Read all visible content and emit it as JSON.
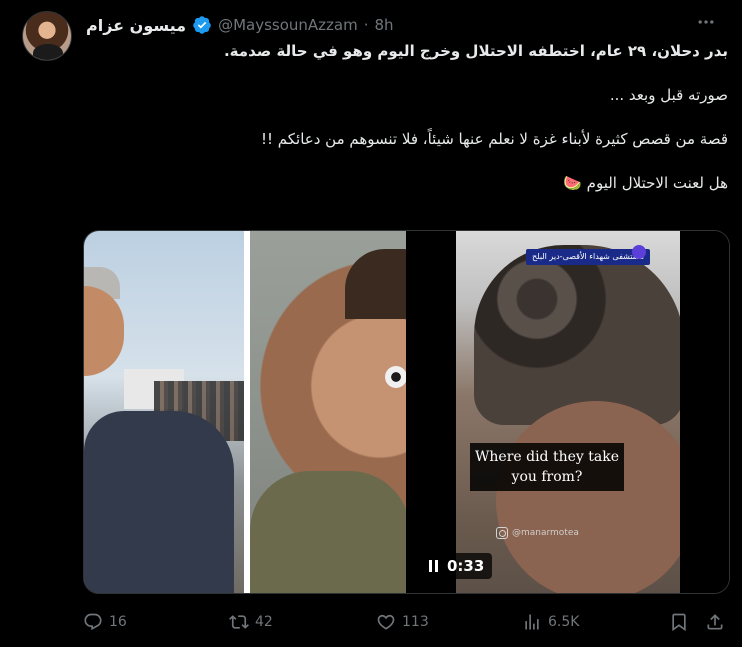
{
  "author": {
    "display_name": "ميسون عزام",
    "handle": "@MayssounAzzam",
    "separator": "·",
    "time": "8h",
    "verified": true
  },
  "tweet": {
    "paragraphs": [
      "بدر دحلان، ٢٩ عام، اختطفه الاحتلال وخرج اليوم وهو في حالة صدمة.",
      "صورته قبل وبعد ...",
      "قصة من قصص كثيرة لأبناء غزة لا نعلم عنها شيئاً، فلا تنسوهم من دعائكم !!",
      "هل لعنت الاحتلال اليوم 🍉"
    ]
  },
  "media": {
    "video_badge": "مستشفى شهداء الأقصى-دير البلح",
    "caption": "Where did they take you from?",
    "watermark": "@manarmotea",
    "duration": "0:33"
  },
  "actions": {
    "replies": "16",
    "reposts": "42",
    "likes": "113",
    "views": "6.5K"
  },
  "colors": {
    "background": "#000000",
    "text": "#e7e9ea",
    "muted": "#71767b",
    "verified_badge": "#1d9bf0"
  },
  "icons": [
    "more-icon",
    "verified-icon",
    "reply-icon",
    "repost-icon",
    "like-icon",
    "views-icon",
    "bookmark-icon",
    "share-icon",
    "pause-icon",
    "instagram-icon"
  ]
}
